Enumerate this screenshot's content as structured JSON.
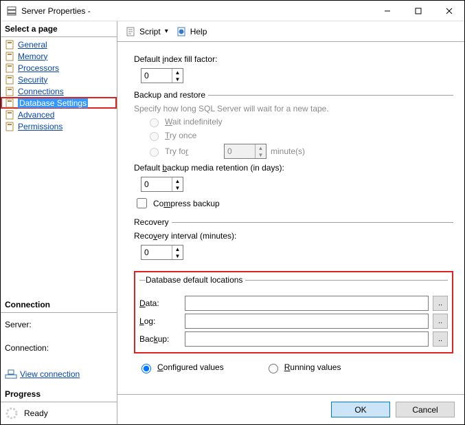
{
  "window": {
    "title": "Server Properties -"
  },
  "sidebar": {
    "select_page_title": "Select a page",
    "items": [
      {
        "label": "General"
      },
      {
        "label": "Memory"
      },
      {
        "label": "Processors"
      },
      {
        "label": "Security"
      },
      {
        "label": "Connections"
      },
      {
        "label": "Database Settings",
        "selected": true
      },
      {
        "label": "Advanced"
      },
      {
        "label": "Permissions"
      }
    ],
    "connection_title": "Connection",
    "server_label": "Server:",
    "connection_label": "Connection:",
    "view_connection": "View connection ",
    "progress_title": "Progress",
    "progress_status": "Ready"
  },
  "toolbar": {
    "script": "Script",
    "help": "Help"
  },
  "form": {
    "fill_factor_label": "Default index fill factor:",
    "fill_factor_value": "0",
    "backup_restore_legend": "Backup and restore",
    "backup_restore_hint": "Specify how long SQL Server will wait for a new tape.",
    "wait_indef": "Wait indefinitely",
    "try_once": "Try once",
    "try_for": "Try for",
    "try_for_value": "0",
    "minutes_label": "minute(s)",
    "retention_label": "Default backup media retention (in days):",
    "retention_value": "0",
    "compress_label": "Compress backup",
    "recovery_legend": "Recovery",
    "recovery_interval_label": "Recovery interval (minutes):",
    "recovery_interval_value": "0",
    "locations_legend": "Database default locations",
    "data_label": "Data:",
    "log_label": "Log:",
    "backup_label": "Backup:",
    "data_value": "",
    "log_value": "",
    "backup_value": "",
    "configured_values": "Configured values",
    "running_values": "Running values"
  },
  "footer": {
    "ok": "OK",
    "cancel": "Cancel"
  }
}
